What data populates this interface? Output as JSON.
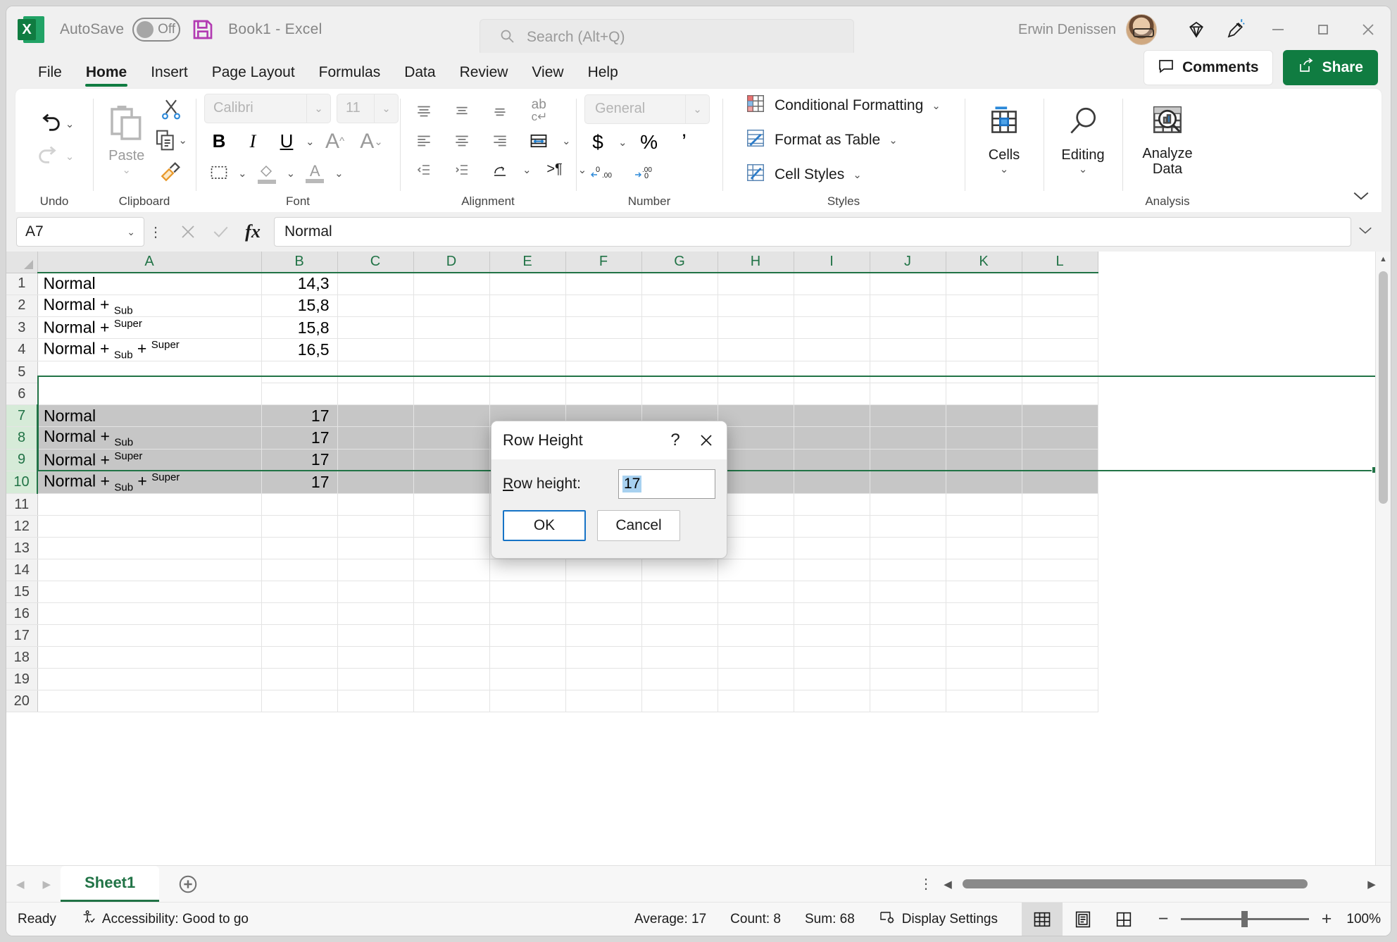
{
  "titlebar": {
    "app_icon": "excel-logo",
    "autosave_label": "AutoSave",
    "autosave_state": "Off",
    "save_icon": "save-icon",
    "document_title": "Book1  -  Excel",
    "user_name": "Erwin Denissen",
    "diamond_icon": "diamond-icon",
    "highlighter_icon": "highlighter-icon",
    "minimize": "minimize-icon",
    "maximize": "maximize-icon",
    "close": "close-icon"
  },
  "search": {
    "placeholder": "Search (Alt+Q)",
    "icon": "search-icon"
  },
  "ribbon_tabs": [
    {
      "label": "File",
      "active": false
    },
    {
      "label": "Home",
      "active": true
    },
    {
      "label": "Insert",
      "active": false
    },
    {
      "label": "Page Layout",
      "active": false
    },
    {
      "label": "Formulas",
      "active": false
    },
    {
      "label": "Data",
      "active": false
    },
    {
      "label": "Review",
      "active": false
    },
    {
      "label": "View",
      "active": false
    },
    {
      "label": "Help",
      "active": false
    }
  ],
  "tab_actions": {
    "comments_label": "Comments",
    "share_label": "Share"
  },
  "ribbon": {
    "groups": [
      {
        "label": "Undo"
      },
      {
        "label": "Clipboard"
      },
      {
        "label": "Font"
      },
      {
        "label": "Alignment"
      },
      {
        "label": "Number"
      },
      {
        "label": "Styles"
      },
      {
        "label": "Analysis"
      }
    ],
    "undo": {
      "undo_icon": "undo-icon",
      "redo_icon": "redo-icon"
    },
    "clipboard": {
      "paste_label": "Paste",
      "cut_icon": "scissors-icon",
      "copy_icon": "copy-icon",
      "format_painter_icon": "format-painter-icon"
    },
    "font": {
      "font_name": "Calibri",
      "font_size": "11",
      "bold": "B",
      "italic": "I",
      "underline": "U",
      "grow_font": "A",
      "shrink_font": "A"
    },
    "number": {
      "format": "General",
      "currency": "$",
      "percent": "%",
      "comma": ","
    },
    "styles": {
      "conditional_formatting": "Conditional Formatting",
      "format_as_table": "Format as Table",
      "cell_styles": "Cell Styles"
    },
    "cells_label": "Cells",
    "editing_label": "Editing",
    "analyze_label": "Analyze\nData",
    "analyze_line1": "Analyze",
    "analyze_line2": "Data"
  },
  "formula_bar": {
    "name_box": "A7",
    "cancel_icon": "cancel-icon",
    "enter_icon": "enter-icon",
    "function_icon": "fx-icon",
    "content": "Normal"
  },
  "grid": {
    "columns": [
      "A",
      "B",
      "C",
      "D",
      "E",
      "F",
      "G",
      "H",
      "I",
      "J",
      "K",
      "L"
    ],
    "active_cell": "A7",
    "rows": [
      {
        "n": "1",
        "a_prefix": "Normal",
        "a_sub": "",
        "a_mid": "",
        "a_super": "",
        "b": "14,3",
        "selected": false
      },
      {
        "n": "2",
        "a_prefix": "Normal + ",
        "a_sub": "Sub",
        "a_mid": "",
        "a_super": "",
        "b": "15,8",
        "selected": false
      },
      {
        "n": "3",
        "a_prefix": "Normal + ",
        "a_sub": "",
        "a_mid": "",
        "a_super": "Super",
        "b": "15,8",
        "selected": false
      },
      {
        "n": "4",
        "a_prefix": "Normal + ",
        "a_sub": "Sub",
        "a_mid": " + ",
        "a_super": "Super",
        "b": "16,5",
        "selected": false
      },
      {
        "n": "5",
        "a_prefix": "",
        "a_sub": "",
        "a_mid": "",
        "a_super": "",
        "b": "",
        "selected": false
      },
      {
        "n": "6",
        "a_prefix": "",
        "a_sub": "",
        "a_mid": "",
        "a_super": "",
        "b": "",
        "selected": false
      },
      {
        "n": "7",
        "a_prefix": "Normal",
        "a_sub": "",
        "a_mid": "",
        "a_super": "",
        "b": "17",
        "selected": true
      },
      {
        "n": "8",
        "a_prefix": "Normal + ",
        "a_sub": "Sub",
        "a_mid": "",
        "a_super": "",
        "b": "17",
        "selected": true
      },
      {
        "n": "9",
        "a_prefix": "Normal + ",
        "a_sub": "",
        "a_mid": "",
        "a_super": "Super",
        "b": "17",
        "selected": true
      },
      {
        "n": "10",
        "a_prefix": "Normal + ",
        "a_sub": "Sub",
        "a_mid": " + ",
        "a_super": "Super",
        "b": "17",
        "selected": true
      },
      {
        "n": "11",
        "a_prefix": "",
        "a_sub": "",
        "a_mid": "",
        "a_super": "",
        "b": "",
        "selected": false
      },
      {
        "n": "12",
        "a_prefix": "",
        "a_sub": "",
        "a_mid": "",
        "a_super": "",
        "b": "",
        "selected": false
      },
      {
        "n": "13",
        "a_prefix": "",
        "a_sub": "",
        "a_mid": "",
        "a_super": "",
        "b": "",
        "selected": false
      },
      {
        "n": "14",
        "a_prefix": "",
        "a_sub": "",
        "a_mid": "",
        "a_super": "",
        "b": "",
        "selected": false
      },
      {
        "n": "15",
        "a_prefix": "",
        "a_sub": "",
        "a_mid": "",
        "a_super": "",
        "b": "",
        "selected": false
      },
      {
        "n": "16",
        "a_prefix": "",
        "a_sub": "",
        "a_mid": "",
        "a_super": "",
        "b": "",
        "selected": false
      },
      {
        "n": "17",
        "a_prefix": "",
        "a_sub": "",
        "a_mid": "",
        "a_super": "",
        "b": "",
        "selected": false
      },
      {
        "n": "18",
        "a_prefix": "",
        "a_sub": "",
        "a_mid": "",
        "a_super": "",
        "b": "",
        "selected": false
      },
      {
        "n": "19",
        "a_prefix": "",
        "a_sub": "",
        "a_mid": "",
        "a_super": "",
        "b": "",
        "selected": false
      },
      {
        "n": "20",
        "a_prefix": "",
        "a_sub": "",
        "a_mid": "",
        "a_super": "",
        "b": "",
        "selected": false
      }
    ]
  },
  "dialog": {
    "title": "Row Height",
    "help": "?",
    "close": "X",
    "label_accel": "R",
    "label_rest": "ow height:",
    "value": "17",
    "ok_label": "OK",
    "cancel_label": "Cancel"
  },
  "sheet_tabs": {
    "prev_icon": "prev-sheet-icon",
    "next_icon": "next-sheet-icon",
    "tabs": [
      "Sheet1"
    ],
    "active": "Sheet1",
    "add_icon": "add-sheet-icon"
  },
  "statusbar": {
    "mode": "Ready",
    "accessibility_icon": "accessibility-icon",
    "accessibility": "Accessibility: Good to go",
    "average": "Average: 17",
    "count": "Count: 8",
    "sum": "Sum: 68",
    "display_settings": "Display Settings",
    "view_normal": "normal-view-icon",
    "view_page_layout": "page-layout-view-icon",
    "view_page_break": "page-break-view-icon",
    "zoom_out": "zoom-out-icon",
    "zoom_in": "zoom-in-icon",
    "zoom_level": "100%"
  },
  "colors": {
    "excel_green": "#107c41",
    "header_green": "#217346",
    "selection_gray": "#c6c6c6",
    "accent_blue": "#1673c6"
  }
}
